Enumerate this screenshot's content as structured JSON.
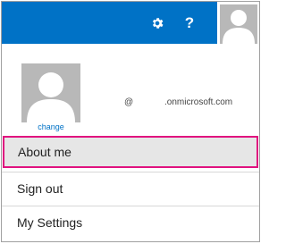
{
  "header": {
    "settings_icon": "gear-icon",
    "help_label": "?",
    "avatar_icon": "user-silhouette-icon",
    "accent_color": "#0072c6"
  },
  "profile": {
    "avatar_icon": "user-silhouette-icon",
    "change_link": "change",
    "user_at": "@",
    "user_domain": ".onmicrosoft.com"
  },
  "menu": {
    "items": [
      {
        "label": "About me",
        "highlighted": true,
        "highlight_color": "#e0127f"
      },
      {
        "label": "Sign out"
      },
      {
        "label": "My Settings"
      }
    ]
  }
}
